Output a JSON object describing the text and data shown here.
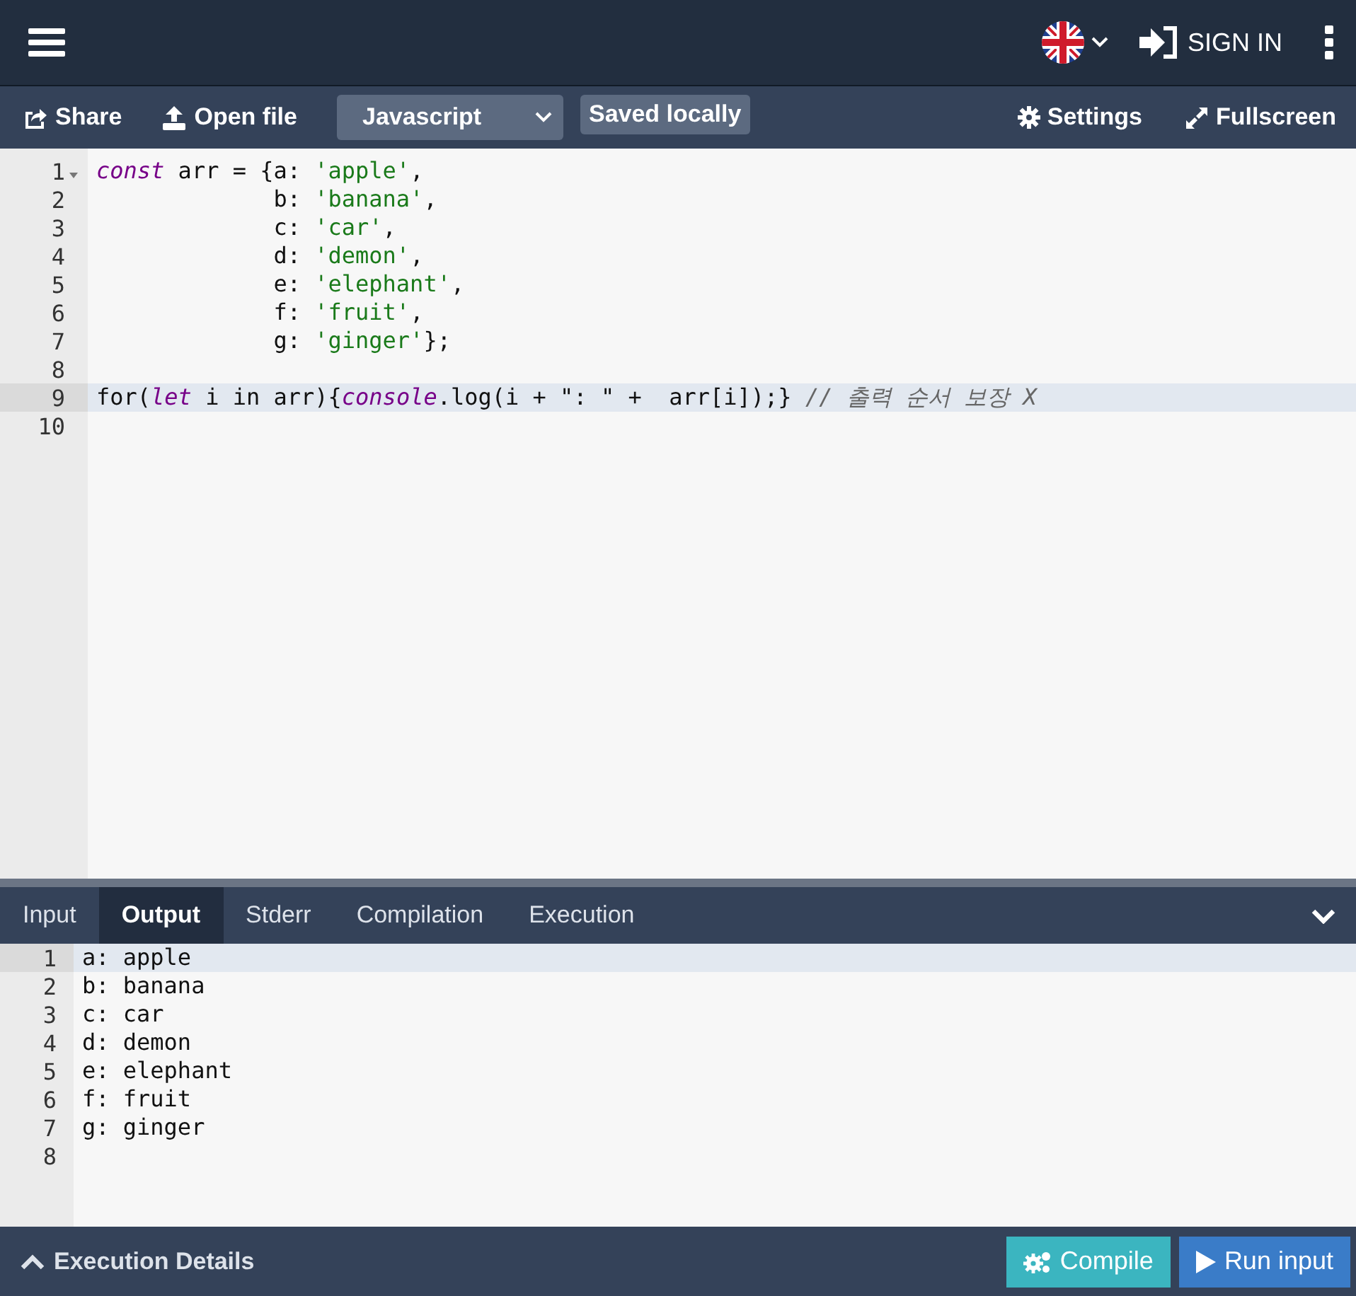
{
  "topbar": {
    "sign_in": "SIGN IN"
  },
  "toolbar": {
    "share": "Share",
    "open_file": "Open file",
    "language": "Javascript",
    "save_status": "Saved locally",
    "settings": "Settings",
    "fullscreen": "Fullscreen"
  },
  "editor": {
    "lines": [
      {
        "number": "1",
        "fold": true,
        "active": false,
        "tokens": [
          {
            "kind": "keyword",
            "text": "const"
          },
          {
            "kind": "plain",
            "text": " arr = {a: "
          },
          {
            "kind": "string",
            "text": "'apple'"
          },
          {
            "kind": "plain",
            "text": ","
          }
        ]
      },
      {
        "number": "2",
        "fold": false,
        "active": false,
        "tokens": [
          {
            "kind": "plain",
            "text": "             b: "
          },
          {
            "kind": "string",
            "text": "'banana'"
          },
          {
            "kind": "plain",
            "text": ","
          }
        ]
      },
      {
        "number": "3",
        "fold": false,
        "active": false,
        "tokens": [
          {
            "kind": "plain",
            "text": "             c: "
          },
          {
            "kind": "string",
            "text": "'car'"
          },
          {
            "kind": "plain",
            "text": ","
          }
        ]
      },
      {
        "number": "4",
        "fold": false,
        "active": false,
        "tokens": [
          {
            "kind": "plain",
            "text": "             d: "
          },
          {
            "kind": "string",
            "text": "'demon'"
          },
          {
            "kind": "plain",
            "text": ","
          }
        ]
      },
      {
        "number": "5",
        "fold": false,
        "active": false,
        "tokens": [
          {
            "kind": "plain",
            "text": "             e: "
          },
          {
            "kind": "string",
            "text": "'elephant'"
          },
          {
            "kind": "plain",
            "text": ","
          }
        ]
      },
      {
        "number": "6",
        "fold": false,
        "active": false,
        "tokens": [
          {
            "kind": "plain",
            "text": "             f: "
          },
          {
            "kind": "string",
            "text": "'fruit'"
          },
          {
            "kind": "plain",
            "text": ","
          }
        ]
      },
      {
        "number": "7",
        "fold": false,
        "active": false,
        "tokens": [
          {
            "kind": "plain",
            "text": "             g: "
          },
          {
            "kind": "string",
            "text": "'ginger'"
          },
          {
            "kind": "plain",
            "text": "};"
          }
        ]
      },
      {
        "number": "8",
        "fold": false,
        "active": false
      },
      {
        "number": "9",
        "fold": false,
        "active": true,
        "tokens": [
          {
            "kind": "plain",
            "text": "for("
          },
          {
            "kind": "keyword",
            "text": "let"
          },
          {
            "kind": "plain",
            "text": " i in arr){"
          },
          {
            "kind": "keyword",
            "text": "console"
          },
          {
            "kind": "plain",
            "text": ".log(i + \": \" +  arr[i]);} "
          },
          {
            "kind": "comment",
            "text": "// 출력 순서 보장 X"
          }
        ]
      },
      {
        "number": "10",
        "fold": false,
        "active": false
      }
    ]
  },
  "output_tabs": [
    {
      "label": "Input",
      "selected": false
    },
    {
      "label": "Output",
      "selected": true
    },
    {
      "label": "Stderr",
      "selected": false
    },
    {
      "label": "Compilation",
      "selected": false
    },
    {
      "label": "Execution",
      "selected": false
    }
  ],
  "output": {
    "lines": [
      {
        "number": "1",
        "text": "a: apple",
        "active": true
      },
      {
        "number": "2",
        "text": "b: banana",
        "active": false
      },
      {
        "number": "3",
        "text": "c: car",
        "active": false
      },
      {
        "number": "4",
        "text": "d: demon",
        "active": false
      },
      {
        "number": "5",
        "text": "e: elephant",
        "active": false
      },
      {
        "number": "6",
        "text": "f: fruit",
        "active": false
      },
      {
        "number": "7",
        "text": "g: ginger",
        "active": false
      },
      {
        "number": "8",
        "active": false
      }
    ]
  },
  "footer": {
    "details": "Execution Details",
    "compile": "Compile",
    "run": "Run input"
  }
}
